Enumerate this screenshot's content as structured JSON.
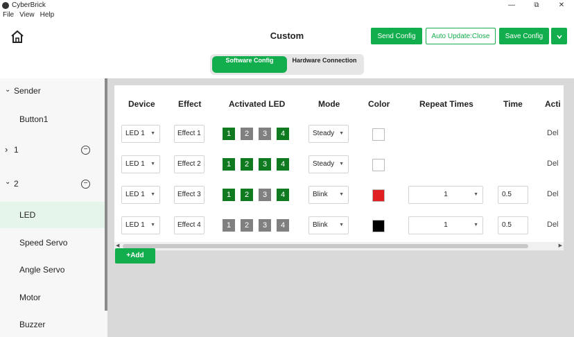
{
  "window": {
    "title": "CyberBrick",
    "controls": {
      "minimize": "—",
      "maximize": "⧉",
      "close": "✕"
    }
  },
  "menu": [
    "File",
    "View",
    "Help"
  ],
  "header": {
    "title": "Custom",
    "send_config": "Send Config",
    "auto_update": "Auto Update:Close",
    "save_config": "Save Config",
    "dropdown_icon": "chevron-down"
  },
  "tabs": {
    "software": "Software Config",
    "hardware": "Hardware Connection",
    "active": "software"
  },
  "sidebar": {
    "sender": {
      "label": "Sender",
      "chevron": "⌄"
    },
    "button1": "Button1",
    "group1": {
      "label": "1",
      "chevron": "›",
      "remove": "−"
    },
    "group2": {
      "label": "2",
      "chevron": "⌄",
      "remove": "−"
    },
    "items": [
      "LED",
      "Speed Servo",
      "Angle Servo",
      "Motor",
      "Buzzer"
    ],
    "selected": "LED"
  },
  "table": {
    "headers": [
      "Device",
      "Effect",
      "Activated LED",
      "Mode",
      "Color",
      "Repeat Times",
      "Time",
      "Acti"
    ],
    "rows": [
      {
        "device": "LED 1",
        "effect": "Effect 1",
        "leds": [
          "1",
          "2",
          "3",
          "4"
        ],
        "led_on": [
          true,
          false,
          false,
          true
        ],
        "mode": "Steady",
        "color": "#ffffff",
        "repeat": "",
        "time": "",
        "action": "Del"
      },
      {
        "device": "LED 1",
        "effect": "Effect 2",
        "leds": [
          "1",
          "2",
          "3",
          "4"
        ],
        "led_on": [
          true,
          true,
          true,
          true
        ],
        "mode": "Steady",
        "color": "#ffffff",
        "repeat": "",
        "time": "",
        "action": "Del"
      },
      {
        "device": "LED 1",
        "effect": "Effect 3",
        "leds": [
          "1",
          "2",
          "3",
          "4"
        ],
        "led_on": [
          true,
          true,
          false,
          true
        ],
        "mode": "Blink",
        "color": "#e02020",
        "repeat": "1",
        "time": "0.5",
        "action": "Del"
      },
      {
        "device": "LED 1",
        "effect": "Effect 4",
        "leds": [
          "1",
          "2",
          "3",
          "4"
        ],
        "led_on": [
          false,
          false,
          false,
          false
        ],
        "mode": "Blink",
        "color": "#000000",
        "repeat": "1",
        "time": "0.5",
        "action": "Del"
      }
    ]
  },
  "add_button": "+Add",
  "colors": {
    "accent": "#12ad4c",
    "led_on": "#0f7a1f",
    "led_off": "#808080"
  }
}
